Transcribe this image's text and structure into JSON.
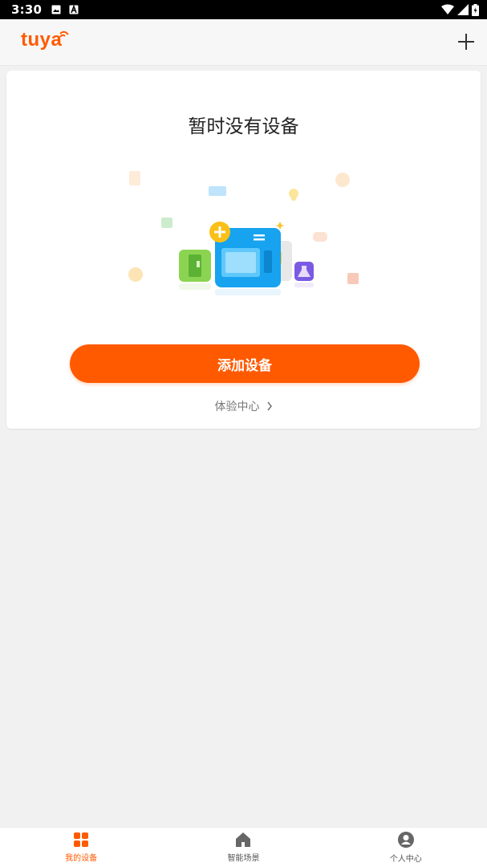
{
  "status_bar": {
    "time": "3:30"
  },
  "app_bar": {
    "logo": "tuya"
  },
  "empty_state": {
    "title": "暂时没有设备",
    "add_device_button": "添加设备",
    "experience_center_link": "体验中心"
  },
  "bottom_nav": {
    "items": [
      {
        "label": "我的设备",
        "icon": "grid-icon",
        "active": true
      },
      {
        "label": "智能场景",
        "icon": "home-icon",
        "active": false
      },
      {
        "label": "个人中心",
        "icon": "profile-icon",
        "active": false
      }
    ]
  },
  "colors": {
    "accent": "#ff5a00",
    "background": "#f1f1f1"
  }
}
